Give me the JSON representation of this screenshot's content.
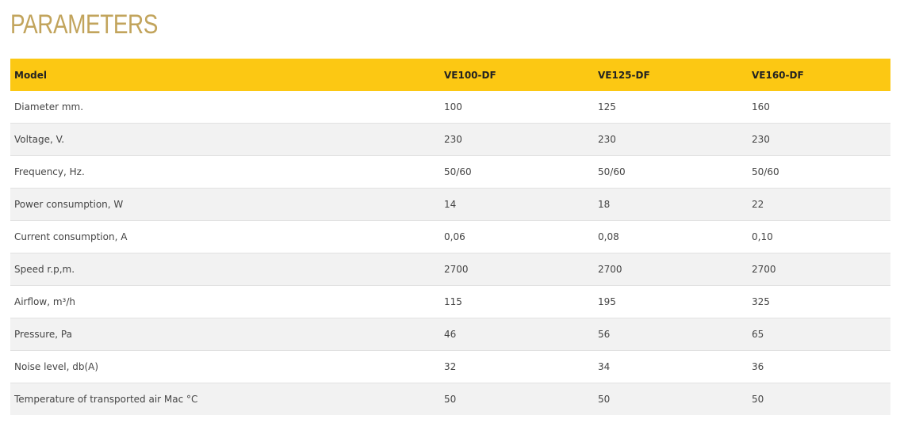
{
  "page": {
    "title": "PARAMETERS"
  },
  "table": {
    "headers": [
      "Model",
      "VE100-DF",
      "VE125-DF",
      "VE160-DF"
    ],
    "rows": [
      [
        "Diameter mm.",
        "100",
        "125",
        "160"
      ],
      [
        "Voltage, V.",
        "230",
        "230",
        "230"
      ],
      [
        "Frequency, Hz.",
        "50/60",
        "50/60",
        "50/60"
      ],
      [
        "Power consumption, W",
        "14",
        "18",
        "22"
      ],
      [
        "Current consumption, A",
        "0,06",
        "0,08",
        "0,10"
      ],
      [
        "Speed r.p,m.",
        "2700",
        "2700",
        "2700"
      ],
      [
        "Airflow, m³/h",
        "115",
        "195",
        "325"
      ],
      [
        "Pressure, Pa",
        "46",
        "56",
        "65"
      ],
      [
        "Noise level, db(A)",
        "32",
        "34",
        "36"
      ],
      [
        "Temperature of transported air Mac °C",
        "50",
        "50",
        "50"
      ]
    ]
  },
  "colors": {
    "title": "#c2a45c",
    "header_background": "#fcc813",
    "stripe_background": "#f2f2f2",
    "row_border": "#e1e1e1"
  }
}
